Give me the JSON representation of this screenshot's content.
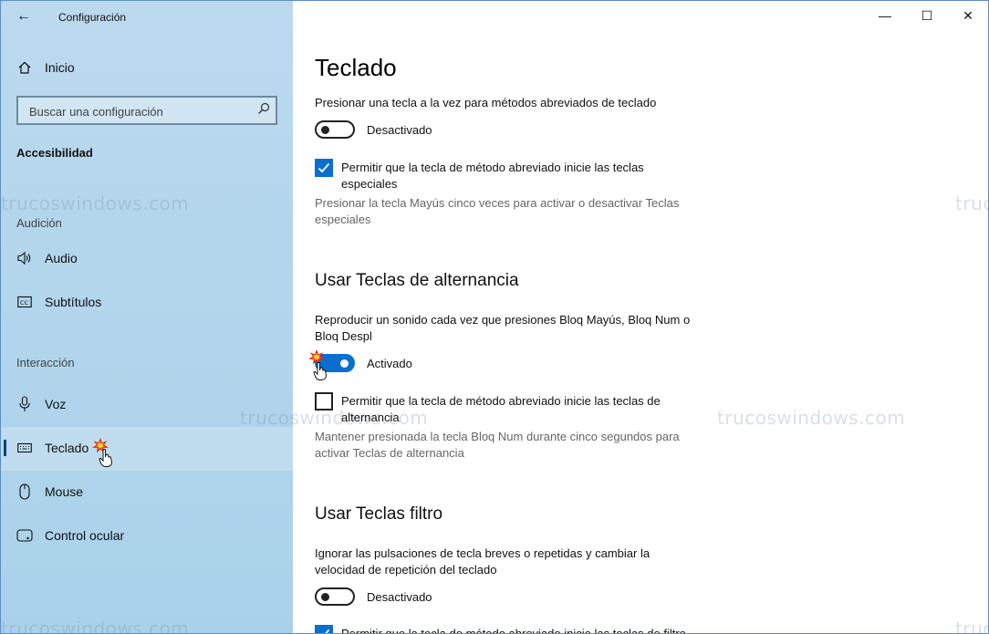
{
  "window": {
    "title": "Configuración",
    "controls": {
      "minimize": "—",
      "maximize": "☐",
      "close": "✕"
    }
  },
  "sidebar": {
    "back_icon": "←",
    "home": {
      "label": "Inicio",
      "icon": "home-icon"
    },
    "search": {
      "placeholder": "Buscar una configuración",
      "icon": "search-icon"
    },
    "section_title": "Accesibilidad",
    "groups": [
      {
        "label": "Audición",
        "items": [
          {
            "label": "Audio",
            "icon": "speaker-icon"
          },
          {
            "label": "Subtítulos",
            "icon": "captions-icon"
          }
        ]
      },
      {
        "label": "Interacción",
        "items": [
          {
            "label": "Voz",
            "icon": "microphone-icon"
          },
          {
            "label": "Teclado",
            "icon": "keyboard-icon",
            "selected": true
          },
          {
            "label": "Mouse",
            "icon": "mouse-icon"
          },
          {
            "label": "Control ocular",
            "icon": "eye-control-icon"
          }
        ]
      }
    ]
  },
  "watermark": "trucoswindows.com",
  "content": {
    "title": "Teclado",
    "sticky": {
      "description": "Presionar una tecla a la vez para métodos abreviados de teclado",
      "toggle_state": "off",
      "toggle_label": "Desactivado",
      "checkbox_checked": true,
      "checkbox_line1": "Permitir que la tecla de método abreviado inicie las teclas",
      "checkbox_line2": "especiales",
      "hint_line1": "Presionar la tecla Mayús cinco veces para activar o desactivar Teclas",
      "hint_line2": "especiales"
    },
    "toggle_keys": {
      "heading": "Usar Teclas de alternancia",
      "description_line1": "Reproducir un sonido cada vez que presiones Bloq Mayús, Bloq Num o",
      "description_line2": "Bloq Despl",
      "toggle_state": "on",
      "toggle_label": "Activado",
      "checkbox_checked": false,
      "checkbox_line1": "Permitir que la tecla de método abreviado inicie las teclas de",
      "checkbox_line2": "alternancia",
      "hint_line1": "Mantener presionada la tecla Bloq Num durante cinco segundos para",
      "hint_line2": "activar Teclas de alternancia"
    },
    "filter_keys": {
      "heading": "Usar Teclas filtro",
      "description_line1": "Ignorar las pulsaciones de tecla breves o repetidas y cambiar la",
      "description_line2": "velocidad de repetición del teclado",
      "toggle_state": "off",
      "toggle_label": "Desactivado",
      "checkbox_checked": true,
      "checkbox_line1": "Permitir que la tecla de método abreviado inicie las teclas de filtro"
    }
  }
}
